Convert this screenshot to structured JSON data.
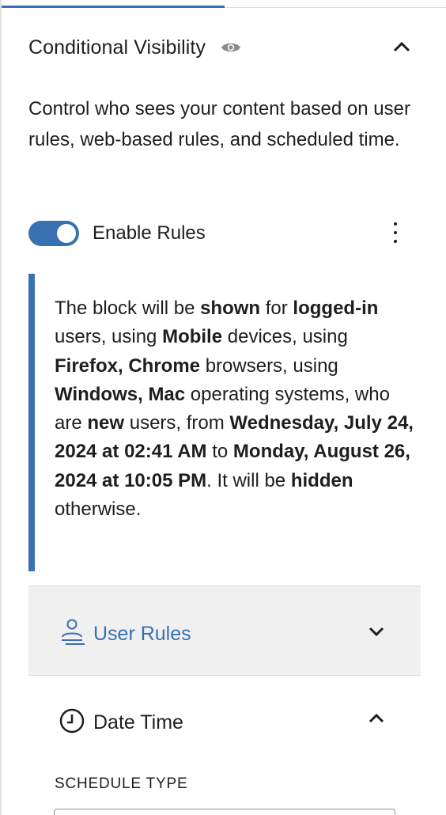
{
  "panel": {
    "title": "Conditional Visibility",
    "description": "Control who sees your content based on user rules, web-based rules, and scheduled time."
  },
  "toggle": {
    "label": "Enable Rules",
    "enabled": true
  },
  "summary": {
    "segments": [
      {
        "text": "The block will be ",
        "bold": false
      },
      {
        "text": "shown",
        "bold": true
      },
      {
        "text": " for ",
        "bold": false
      },
      {
        "text": "logged-in",
        "bold": true
      },
      {
        "text": " users, using ",
        "bold": false
      },
      {
        "text": "Mobile",
        "bold": true
      },
      {
        "text": " devices, using ",
        "bold": false
      },
      {
        "text": "Firefox, Chrome",
        "bold": true
      },
      {
        "text": " browsers, using ",
        "bold": false
      },
      {
        "text": "Windows, Mac",
        "bold": true
      },
      {
        "text": " operating systems, who are ",
        "bold": false
      },
      {
        "text": "new",
        "bold": true
      },
      {
        "text": " users, from ",
        "bold": false
      },
      {
        "text": "Wednesday, July 24, 2024 at 02:41 AM",
        "bold": true
      },
      {
        "text": " to ",
        "bold": false
      },
      {
        "text": "Monday, August 26, 2024 at 10:05 PM",
        "bold": true
      },
      {
        "text": ". It will be ",
        "bold": false
      },
      {
        "text": "hidden",
        "bold": true
      },
      {
        "text": " otherwise.",
        "bold": false
      }
    ]
  },
  "sections": {
    "user_rules": {
      "label": "User Rules",
      "expanded": false,
      "icon": "user-icon"
    },
    "date_time": {
      "label": "Date Time",
      "expanded": true,
      "icon": "clock-icon"
    }
  },
  "schedule": {
    "label": "SCHEDULE TYPE"
  },
  "colors": {
    "accent": "#3870b1",
    "text": "#1e1e1e",
    "section_bg": "#f0f0f0",
    "eye_icon": "#8a8a8a"
  }
}
